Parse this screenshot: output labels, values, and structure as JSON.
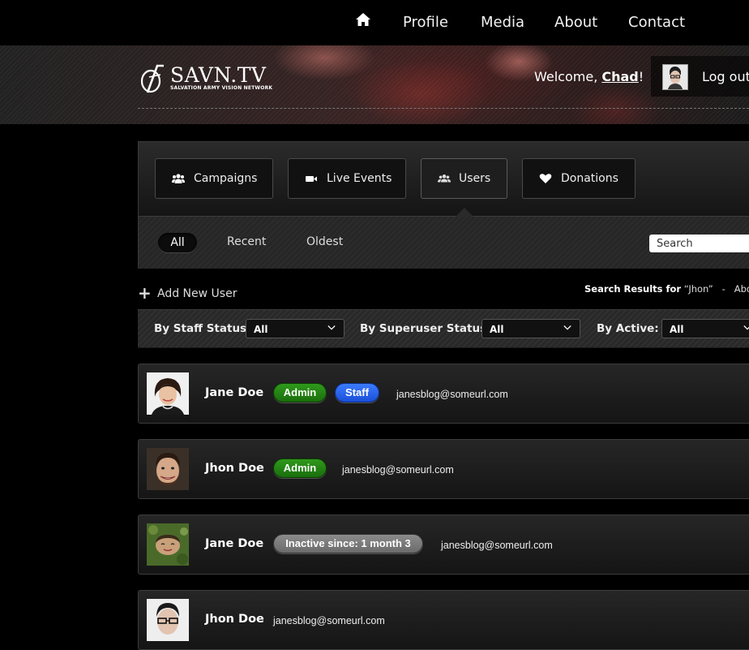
{
  "nav": {
    "home_icon": "home-icon",
    "links": [
      "Profile",
      "Media",
      "About",
      "Contact"
    ]
  },
  "header": {
    "logo_text": "SAVN.TV",
    "logo_subtitle": "SALVATION ARMY VISION NETWORK",
    "welcome_prefix": "Welcome, ",
    "user_name": "Chad",
    "welcome_suffix": "!",
    "logout_label": "Log out"
  },
  "tabs": [
    {
      "label": "Campaigns",
      "icon": "group-icon"
    },
    {
      "label": "Live Events",
      "icon": "video-camera-icon"
    },
    {
      "label": "Users",
      "icon": "users-icon",
      "active": true
    },
    {
      "label": "Donations",
      "icon": "heart-icon"
    }
  ],
  "sort": {
    "options": [
      "All",
      "Recent",
      "Oldest"
    ],
    "selected": "All"
  },
  "search": {
    "placeholder": "Search"
  },
  "add_user_label": "Add New User",
  "results": {
    "prefix": "Search Results for",
    "query": "“Jhon”",
    "separator": "-",
    "trailing": "Abo"
  },
  "filters": [
    {
      "label": "By Staff Status",
      "value": "All"
    },
    {
      "label": "By Superuser Status",
      "value": "All"
    },
    {
      "label": "By Active:",
      "value": "All"
    }
  ],
  "users": [
    {
      "name": "Jane Doe",
      "badges": [
        {
          "text": "Admin",
          "type": "admin"
        },
        {
          "text": "Staff",
          "type": "staff"
        }
      ],
      "email": "janesblog@someurl.com"
    },
    {
      "name": "Jhon Doe",
      "badges": [
        {
          "text": "Admin",
          "type": "admin"
        }
      ],
      "email": "janesblog@someurl.com"
    },
    {
      "name": "Jane Doe",
      "badges": [
        {
          "text": "Inactive since: 1 month 3",
          "type": "inactive"
        }
      ],
      "email": "janesblog@someurl.com"
    },
    {
      "name": "Jhon Doe",
      "badges": [],
      "email": "janesblog@someurl.com"
    }
  ],
  "colors": {
    "admin": "#1f7f12",
    "staff": "#2a62f0",
    "inactive": "#7a7a7a"
  }
}
